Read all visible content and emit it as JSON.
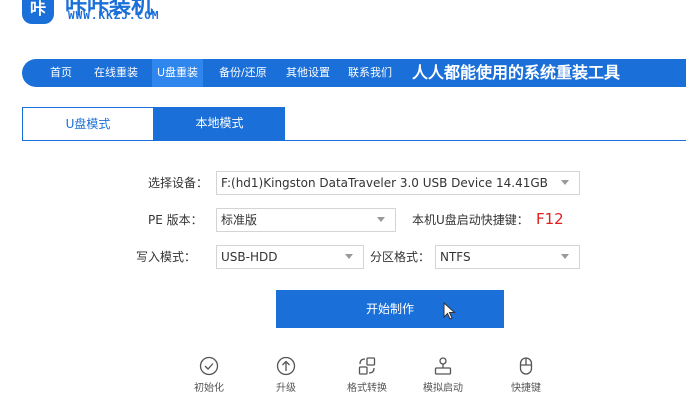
{
  "brand": {
    "icon_text": "咔",
    "title": "咔咔装机",
    "url": "WWW.KKZJ.COM",
    "color": "#1a6fd8"
  },
  "nav": {
    "items": [
      "首页",
      "在线重装",
      "U盘重装",
      "备份/还原",
      "其他设置",
      "联系我们"
    ],
    "active": "U盘重装",
    "slogan": "人人都能使用的系统重装工具"
  },
  "tabs": {
    "udisk": "U盘模式",
    "local": "本地模式",
    "active": "本地模式"
  },
  "form": {
    "device_label": "选择设备：",
    "device_value": "F:(hd1)Kingston DataTraveler 3.0 USB Device 14.41GB",
    "pe_label": "PE 版本：",
    "pe_value": "标准版",
    "hotkey_label": "本机U盘启动快捷键：",
    "hotkey_value": "F12",
    "write_label": "写入模式：",
    "write_value": "USB-HDD",
    "partition_label": "分区格式：",
    "partition_value": "NTFS"
  },
  "start_button": "开始制作",
  "tools": [
    {
      "label": "初始化",
      "icon": "check-circle-icon"
    },
    {
      "label": "升级",
      "icon": "upload-arrow-icon"
    },
    {
      "label": "格式转换",
      "icon": "convert-icon"
    },
    {
      "label": "模拟启动",
      "icon": "simulate-icon"
    },
    {
      "label": "快捷键",
      "icon": "mouse-icon"
    }
  ]
}
